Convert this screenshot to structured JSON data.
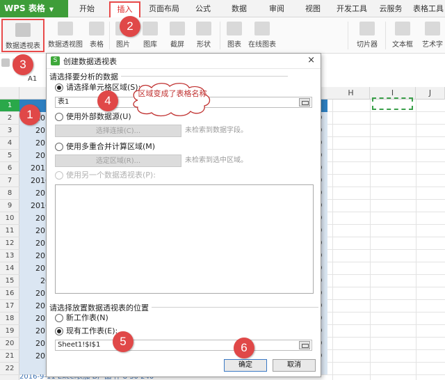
{
  "app": {
    "logo": "WPS 表格"
  },
  "menu": {
    "tabs": [
      {
        "label": "开始"
      },
      {
        "label": "插入",
        "active": true
      },
      {
        "label": "页面布局"
      },
      {
        "label": "公式"
      },
      {
        "label": "数据"
      },
      {
        "label": "审阅"
      },
      {
        "label": "视图"
      },
      {
        "label": "开发工具"
      },
      {
        "label": "云服务"
      },
      {
        "label": "表格工具"
      }
    ]
  },
  "ribbon": {
    "items": [
      {
        "label": "数据透视表",
        "icon": "pivot-table-icon"
      },
      {
        "label": "数据透视图",
        "icon": "pivot-chart-icon"
      },
      {
        "label": "表格",
        "icon": "table-icon"
      },
      {
        "label": "图片",
        "icon": "picture-icon"
      },
      {
        "label": "图库",
        "icon": "gallery-icon"
      },
      {
        "label": "截屏",
        "icon": "screenshot-icon"
      },
      {
        "label": "形状",
        "icon": "shapes-icon"
      },
      {
        "label": "图表",
        "icon": "chart-icon"
      },
      {
        "label": "在线图表",
        "icon": "online-chart-icon"
      },
      {
        "label": "切片器",
        "icon": "slicer-icon"
      },
      {
        "label": "文本框",
        "icon": "textbox-icon"
      },
      {
        "label": "艺术字",
        "icon": "wordart-icon"
      }
    ]
  },
  "name_box": "A1",
  "columns": [
    "H",
    "I",
    "J"
  ],
  "rows": [
    "1",
    "2",
    "3",
    "4",
    "5",
    "6",
    "7",
    "8",
    "9",
    "10",
    "11",
    "12",
    "13",
    "14",
    "15",
    "16",
    "17",
    "18",
    "19",
    "20",
    "21",
    "22"
  ],
  "grid_left_values": [
    "",
    "201",
    "201",
    "201",
    "201",
    "2017",
    "2016",
    "201",
    "2016",
    "201",
    "201",
    "201",
    "201",
    "201",
    "20",
    "201",
    "201",
    "201",
    "201",
    "201",
    "201",
    ""
  ],
  "grid_right_values": [
    "",
    "0",
    "0",
    "0",
    "0",
    "0",
    "0",
    "0",
    "0",
    "0",
    "0",
    "0",
    "0",
    "0",
    "0",
    "0",
    "0",
    "0",
    "0",
    "0",
    "0",
    ""
  ],
  "last_row_text": "2016-9-11  Excel表加  D产品  件  8  30  240",
  "dialog": {
    "title": "创建数据透视表",
    "close": "×",
    "section1": "请选择要分析的数据",
    "opt_cell_range": "请选择单元格区域(S):",
    "cell_range_value": "表1",
    "opt_external": "使用外部数据源(U)",
    "btn_choose_connection": "选择连接(C)...",
    "hint_no_fields": "未检索到数据字段。",
    "opt_multi_consolidate": "使用多重合并计算区域(M)",
    "btn_choose_region": "选定区域(R)...",
    "hint_no_region": "未检索到选中区域。",
    "opt_another_pivot": "使用另一个数据透视表(P):",
    "section2": "请选择放置数据透视表的位置",
    "opt_new_sheet": "新工作表(N)",
    "opt_existing_sheet": "现有工作表(E):",
    "existing_sheet_value": "Sheet1!$I$1",
    "ok": "确定",
    "cancel": "取消"
  },
  "annotations": {
    "badges": [
      "1",
      "2",
      "3",
      "4",
      "5",
      "6"
    ],
    "bubble_text": "区域变成了表格名称",
    "badge_color": "#e04848"
  }
}
